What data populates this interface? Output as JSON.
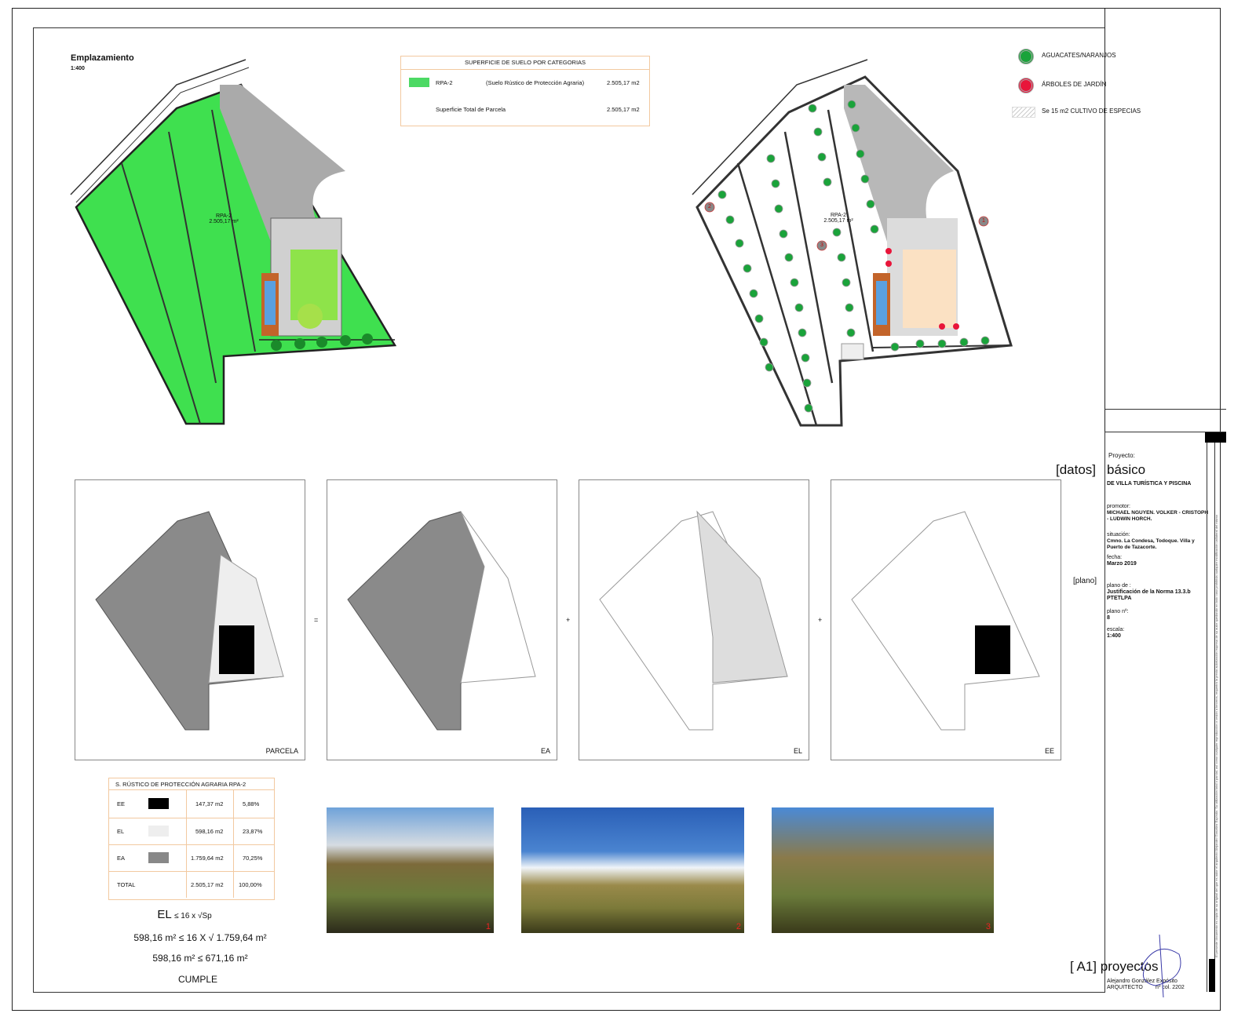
{
  "plan": {
    "title": "Emplazamiento",
    "scale": "1:400",
    "parcel_label": "RPA-2",
    "parcel_area": "2.505,17 m²"
  },
  "category_table": {
    "header": "SUPERFICIE DE SUELO POR CATEGORIAS",
    "row_code": "RPA-2",
    "row_desc": "(Suelo Rústico de Protección Agraria)",
    "row_area": "2.505,17 m2",
    "total_label": "Superficie Total de Parcela",
    "total_area": "2.505,17 m2",
    "swatch_color": "#4cd964"
  },
  "legend": {
    "items": [
      {
        "label": "AGUACATES/NARANJOS",
        "color": "#1aa33a"
      },
      {
        "label": "ÁRBOLES DE JARDÍN",
        "color": "#e8153a"
      },
      {
        "label": "Se 15 m2 CULTIVO DE ESPECIAS",
        "color": "#cccccc"
      }
    ]
  },
  "markers": [
    "1",
    "2",
    "3"
  ],
  "panels": [
    {
      "label": "PARCELA"
    },
    {
      "label": "EA"
    },
    {
      "label": "EL"
    },
    {
      "label": "EE"
    }
  ],
  "operators": [
    "=",
    "+",
    "+"
  ],
  "rpa_table": {
    "header": "S. RÚSTICO DE PROTECCIÓN AGRARIA RPA-2",
    "rows": [
      {
        "code": "EE",
        "area": "147,37 m2",
        "pct": "5,88%",
        "swatch": "#000000"
      },
      {
        "code": "EL",
        "area": "598,16 m2",
        "pct": "23,87%",
        "swatch": "#eeeeee"
      },
      {
        "code": "EA",
        "area": "1.759,64 m2",
        "pct": "70,25%",
        "swatch": "#888888"
      },
      {
        "code": "TOTAL",
        "area": "2.505,17 m2",
        "pct": "100,00%",
        "swatch": ""
      }
    ]
  },
  "formulas": {
    "rule_main": "EL",
    "rule_rest": "≤ 16 x √Sp",
    "line1": "598,16 m² ≤ 16 X √ 1.759,64 m²",
    "line2": "598,16 m² ≤  671,16 m²",
    "verdict": "CUMPLE"
  },
  "photos": [
    "1",
    "2",
    "3"
  ],
  "titleblock": {
    "proyecto_lbl": "Proyecto:",
    "datos": "[datos]",
    "basico": "básico",
    "project_name": "DE VILLA TURÍSTICA Y PISCINA",
    "promotor_lbl": "promotor:",
    "promotor": "MICHAEL NGUYEN. VOLKER - CRISTOPH - LUDWIN HORCH.",
    "situacion_lbl": "situación:",
    "situacion": "Cmno. La Condesa, Todoque. Villa y Puerto de Tazacorte.",
    "fecha_lbl": "fecha:",
    "fecha": "Marzo 2019",
    "plano_tag": "[plano]",
    "plano_de_lbl": "plano de :",
    "plano_de": "Justificación de la Norma 13.3.b PTETLPA",
    "plano_n_lbl": "plano nº:",
    "plano_n": "8",
    "escala_lbl": "escala:",
    "escala": "1:400",
    "brand": "[ A1] proyectos",
    "architect": "Alejandro González Expósito",
    "architect_role": "ARQUITECTO",
    "architect_col": "nº col. 2202",
    "side_note": "El presente documento es copia de su original del que es autor el arquitecto Alejandro González Expósito. Su utilización total o parcial, así como cualquier reproducción o cesión a terceros, requerirá la previa autorización expresa de su autor quedando en todo caso prohibida cualquier modificación unilateral del mismo"
  }
}
